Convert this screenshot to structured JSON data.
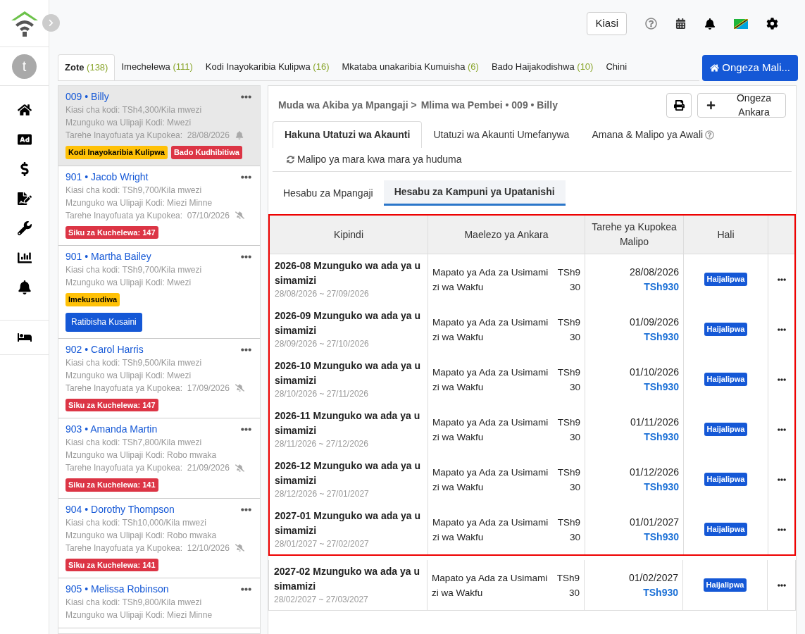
{
  "sidebar": {
    "avatar": "t",
    "items": [
      {
        "kind": "home",
        "selected": false
      },
      {
        "kind": "ad",
        "selected": false
      },
      {
        "kind": "money",
        "selected": false
      },
      {
        "kind": "contract",
        "selected": false
      },
      {
        "kind": "tools",
        "selected": false
      },
      {
        "kind": "reports",
        "selected": false
      },
      {
        "kind": "alerts",
        "selected": false
      },
      {
        "kind": "rooms",
        "selected": false
      }
    ]
  },
  "topbar": {
    "amount_button": "Kiasi"
  },
  "tabs": [
    {
      "label": "Zote",
      "count": "(138)",
      "selected": true
    },
    {
      "label": "Imechelewa",
      "count": "(111)",
      "selected": false
    },
    {
      "label": "Kodi Inayokaribia Kulipwa",
      "count": "(16)",
      "selected": false
    },
    {
      "label": "Mkataba unakaribia Kumuisha",
      "count": "(6)",
      "selected": false
    },
    {
      "label": "Bado Haijakodishwa",
      "count": "(10)",
      "selected": false
    },
    {
      "label": "Chini",
      "selected": false
    }
  ],
  "add_property_button": "Ongeza Mali...",
  "properties": [
    {
      "title": "009 • Billy",
      "selected": true,
      "lines": [
        "Kiasi cha kodi: TSh4,300/Kila mwezi",
        "Mzunguko wa Ulipaji Kodi: Mwezi"
      ],
      "next_date": "Tarehe Inayofuata ya Kupokea:  28/08/2026",
      "reminder": true,
      "badges": [
        {
          "label": "Kodi Inayokaribia Kulipwa",
          "color": "#ffc107"
        },
        {
          "label": "Bado Kudhibitiwa",
          "color": "#dc3545"
        }
      ]
    },
    {
      "title": "901 • Jacob Wright",
      "selected": false,
      "lines": [
        "Kiasi cha kodi: TSh9,700/Kila mwezi",
        "Mzunguko wa Ulipaji Kodi: Miezi Minne"
      ],
      "next_date": "Tarehe Inayofuata ya Kupokea:  07/10/2026",
      "reminder": false,
      "badges": [
        {
          "label": "Siku za Kuchelewa: 147",
          "color": "#dc3545"
        }
      ]
    },
    {
      "title": "901 • Martha Bailey",
      "selected": false,
      "lines": [
        "Kiasi cha kodi: TSh9,700/Kila mwezi",
        "Mzunguko wa Ulipaji Kodi: Mwezi"
      ],
      "badges": [
        {
          "label": "Imekusudiwa",
          "color": "#ffc107"
        }
      ],
      "action": "Ratibisha Kusaini"
    },
    {
      "title": "902 • Carol Harris",
      "selected": false,
      "lines": [
        "Kiasi cha kodi: TSh9,500/Kila mwezi",
        "Mzunguko wa Ulipaji Kodi: Mwezi"
      ],
      "next_date": "Tarehe Inayofuata ya Kupokea:  17/09/2026",
      "reminder": false,
      "badges": [
        {
          "label": "Siku za Kuchelewa: 147",
          "color": "#dc3545"
        }
      ]
    },
    {
      "title": "903 • Amanda Martin",
      "selected": false,
      "lines": [
        "Kiasi cha kodi: TSh7,800/Kila mwezi",
        "Mzunguko wa Ulipaji Kodi: Robo mwaka"
      ],
      "next_date": "Tarehe Inayofuata ya Kupokea:  21/09/2026",
      "reminder": false,
      "badges": [
        {
          "label": "Siku za Kuchelewa: 141",
          "color": "#dc3545"
        }
      ]
    },
    {
      "title": "904 • Dorothy Thompson",
      "selected": false,
      "lines": [
        "Kiasi cha kodi: TSh10,000/Kila mwezi",
        "Mzunguko wa Ulipaji Kodi: Robo mwaka"
      ],
      "next_date": "Tarehe Inayofuata ya Kupokea:  12/10/2026",
      "reminder": false,
      "badges": [
        {
          "label": "Siku za Kuchelewa: 141",
          "color": "#dc3545"
        }
      ]
    },
    {
      "title": "905 • Melissa Robinson",
      "selected": false,
      "lines": [
        "Kiasi cha kodi: TSh9,800/Kila mwezi",
        "Mzunguko wa Ulipaji Kodi: Miezi Minne"
      ]
    }
  ],
  "breadcrumb": [
    "Muda wa Akiba ya Mpangaji >",
    "Mlima wa Pembei • 009 • Billy"
  ],
  "add_invoice_button": "Ongeza Ankara",
  "account_tabs": [
    {
      "label": "Hakuna Utatuzi wa Akaunti",
      "selected": true
    },
    {
      "label": "Utatuzi wa Akaunti Umefanywa",
      "selected": false
    },
    {
      "label": "Amana & Malipo ya Awali",
      "selected": false,
      "help": true
    }
  ],
  "recurring_link": "Malipo ya mara kwa mara ya huduma",
  "ledger_tabs": [
    {
      "label": "Hesabu za Mpangaji",
      "selected": false
    },
    {
      "label": "Hesabu za Kampuni ya Upatanishi",
      "selected": true
    }
  ],
  "table": {
    "columns": [
      "Kipindi",
      "Maelezo ya Ankara",
      "Tarehe ya Kupokea Malipo",
      "Hali"
    ],
    "rows": [
      {
        "period": "2026-08 Mzunguko wa ada ya usimamizi",
        "range": "28/08/2026 ~ 27/09/2026",
        "description": "Mapato ya Ada za Usimamizi wa Wakfu",
        "amount": "TSh930",
        "due": "28/08/2026",
        "balance": "TSh930",
        "status": "Haijalipwa",
        "highlighted": true
      },
      {
        "period": "2026-09 Mzunguko wa ada ya usimamizi",
        "range": "28/09/2026 ~ 27/10/2026",
        "description": "Mapato ya Ada za Usimamizi wa Wakfu",
        "amount": "TSh930",
        "due": "01/09/2026",
        "balance": "TSh930",
        "status": "Haijalipwa",
        "highlighted": true
      },
      {
        "period": "2026-10 Mzunguko wa ada ya usimamizi",
        "range": "28/10/2026 ~ 27/11/2026",
        "description": "Mapato ya Ada za Usimamizi wa Wakfu",
        "amount": "TSh930",
        "due": "01/10/2026",
        "balance": "TSh930",
        "status": "Haijalipwa",
        "highlighted": true
      },
      {
        "period": "2026-11 Mzunguko wa ada ya usimamizi",
        "range": "28/11/2026 ~ 27/12/2026",
        "description": "Mapato ya Ada za Usimamizi wa Wakfu",
        "amount": "TSh930",
        "due": "01/11/2026",
        "balance": "TSh930",
        "status": "Haijalipwa",
        "highlighted": true
      },
      {
        "period": "2026-12 Mzunguko wa ada ya usimamizi",
        "range": "28/12/2026 ~ 27/01/2027",
        "description": "Mapato ya Ada za Usimamizi wa Wakfu",
        "amount": "TSh930",
        "due": "01/12/2026",
        "balance": "TSh930",
        "status": "Haijalipwa",
        "highlighted": true
      },
      {
        "period": "2027-01 Mzunguko wa ada ya usimamizi",
        "range": "28/01/2027 ~ 27/02/2027",
        "description": "Mapato ya Ada za Usimamizi wa Wakfu",
        "amount": "TSh930",
        "due": "01/01/2027",
        "balance": "TSh930",
        "status": "Haijalipwa",
        "highlighted": true
      },
      {
        "period": "2027-02 Mzunguko wa ada ya usimamizi",
        "range": "28/02/2027 ~ 27/03/2027",
        "description": "Mapato ya Ada za Usimamizi wa Wakfu",
        "amount": "TSh930",
        "due": "01/02/2027",
        "balance": "TSh930",
        "status": "Haijalipwa",
        "highlighted": false
      }
    ]
  }
}
